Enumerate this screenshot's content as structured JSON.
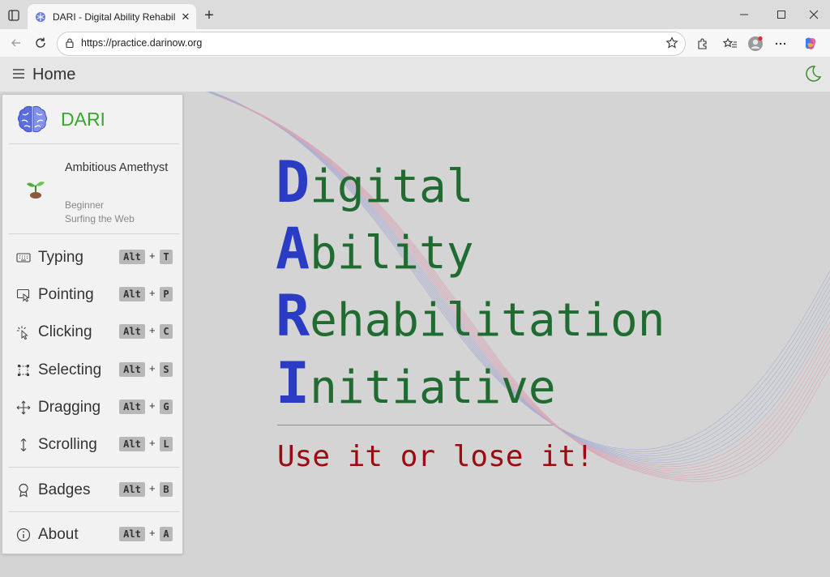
{
  "browser": {
    "tab_title": "DARI - Digital Ability Rehabilitation Initiative",
    "tab_close": "✕",
    "new_tab": "+",
    "url": "https://practice.darinow.org"
  },
  "header": {
    "title": "Home"
  },
  "brand": {
    "name": "DARI"
  },
  "profile": {
    "name": "Ambitious Amethyst",
    "level": "Beginner",
    "status": "Surfing the Web"
  },
  "shortcut": {
    "modifier": "Alt",
    "plus": "+"
  },
  "nav": [
    {
      "label": "Typing",
      "key": "T",
      "icon": "keyboard-icon"
    },
    {
      "label": "Pointing",
      "key": "P",
      "icon": "pointer-icon"
    },
    {
      "label": "Clicking",
      "key": "C",
      "icon": "click-icon"
    },
    {
      "label": "Selecting",
      "key": "S",
      "icon": "select-icon"
    },
    {
      "label": "Dragging",
      "key": "G",
      "icon": "move-icon"
    },
    {
      "label": "Scrolling",
      "key": "L",
      "icon": "scroll-icon"
    },
    {
      "label": "Badges",
      "key": "B",
      "icon": "badge-icon"
    },
    {
      "label": "About",
      "key": "A",
      "icon": "info-icon"
    }
  ],
  "hero": {
    "lines": [
      {
        "cap": "D",
        "rest": "igital"
      },
      {
        "cap": "A",
        "rest": "bility"
      },
      {
        "cap": "R",
        "rest": "ehabilitation"
      },
      {
        "cap": "I",
        "rest": "nitiative"
      }
    ],
    "tagline": "Use it or lose it!"
  },
  "colors": {
    "brand_green": "#3aa62c",
    "hero_blue": "#2a3cc4",
    "hero_green": "#1f6b30",
    "tagline_red": "#9c0a12"
  }
}
